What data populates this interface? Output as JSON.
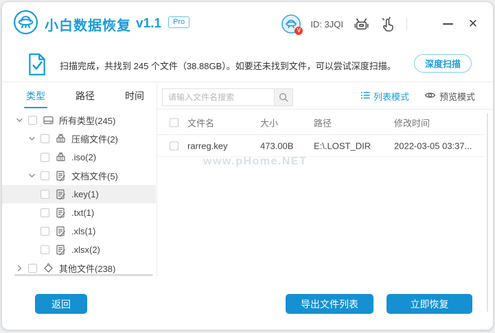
{
  "window": {
    "title": "小白数据恢复",
    "version": "v1.1",
    "badge": "Pro",
    "user_id": "ID: 3JQI",
    "colors": {
      "primary": "#1B9CDB",
      "button_blue": "#1590D2",
      "badge_red": "#F23C30"
    }
  },
  "banner": {
    "text": "扫描完成，共找到 245 个文件（38.88GB）。如要还未找到文件，可以尝试深度扫描。",
    "deep_scan_label": "深度扫描"
  },
  "sidebar": {
    "tabs": [
      {
        "label": "类型",
        "active": true
      },
      {
        "label": "路径",
        "active": false
      },
      {
        "label": "时间",
        "active": false
      }
    ],
    "tree": [
      {
        "label": "所有类型(245)",
        "icon": "drive-icon",
        "level": 0,
        "expanded": true
      },
      {
        "label": "压缩文件(2)",
        "icon": "archive-icon",
        "level": 1,
        "expanded": true
      },
      {
        "label": ".iso(2)",
        "icon": "archive-icon",
        "level": 2
      },
      {
        "label": "文档文件(5)",
        "icon": "document-icon",
        "level": 1,
        "expanded": true
      },
      {
        "label": ".key(1)",
        "icon": "document-icon",
        "level": 2,
        "selected": true
      },
      {
        "label": ".txt(1)",
        "icon": "document-icon",
        "level": 2
      },
      {
        "label": ".xls(1)",
        "icon": "document-icon",
        "level": 2
      },
      {
        "label": ".xlsx(2)",
        "icon": "document-icon",
        "level": 2
      },
      {
        "label": "其他文件(238)",
        "icon": "other-icon",
        "level": 0,
        "collapsed": true
      }
    ]
  },
  "toolbar": {
    "search_placeholder": "请输入文件名搜索",
    "list_mode_label": "列表模式",
    "preview_mode_label": "预览模式"
  },
  "table": {
    "headers": [
      "文件名",
      "大小",
      "路径",
      "修改时间"
    ],
    "rows": [
      {
        "name": "rarreg.key",
        "size": "473.00B",
        "path": "E:\\.LOST_DIR",
        "modified": "2022-03-05 03:37..."
      }
    ]
  },
  "watermark": "www.pHome.NET",
  "footer": {
    "back_label": "返回",
    "export_label": "导出文件列表",
    "recover_label": "立即恢复"
  }
}
